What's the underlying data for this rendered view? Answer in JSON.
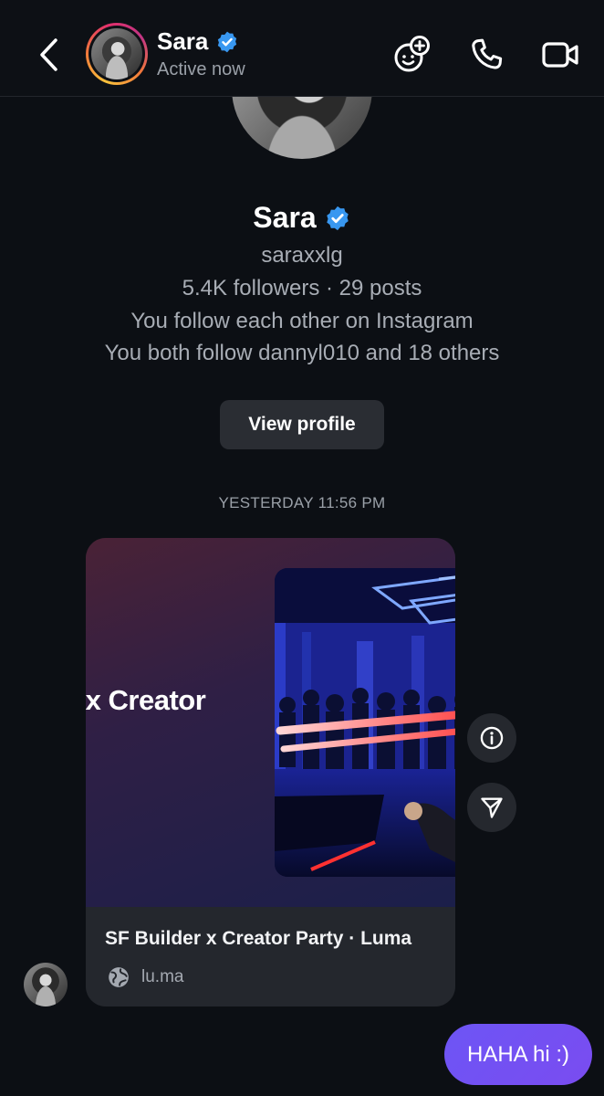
{
  "header": {
    "contact_name": "Sara",
    "status": "Active now"
  },
  "profile": {
    "name": "Sara",
    "username": "saraxxlg",
    "stats": "5.4K followers · 29 posts",
    "relation": "You follow each other on Instagram",
    "mutuals": "You both follow dannyl010 and 18 others",
    "view_profile_label": "View profile"
  },
  "timestamp": "YESTERDAY 11:56 PM",
  "link_card": {
    "media_text": "r x Creator",
    "title": "SF Builder x Creator Party · Luma",
    "domain": "lu.ma"
  },
  "outgoing_message": "HAHA hi :)",
  "colors": {
    "background": "#0c0f14",
    "verified_blue": "#3897f0",
    "bubble": "#6d55f5",
    "card": "#24272d",
    "muted_text": "#a8adb5"
  },
  "icons": {
    "back": "chevron-left-icon",
    "verified": "verified-badge-icon",
    "effects": "emoji-plus-icon",
    "call": "phone-icon",
    "video": "video-camera-icon",
    "info": "info-icon",
    "share": "send-icon",
    "globe": "globe-icon"
  }
}
